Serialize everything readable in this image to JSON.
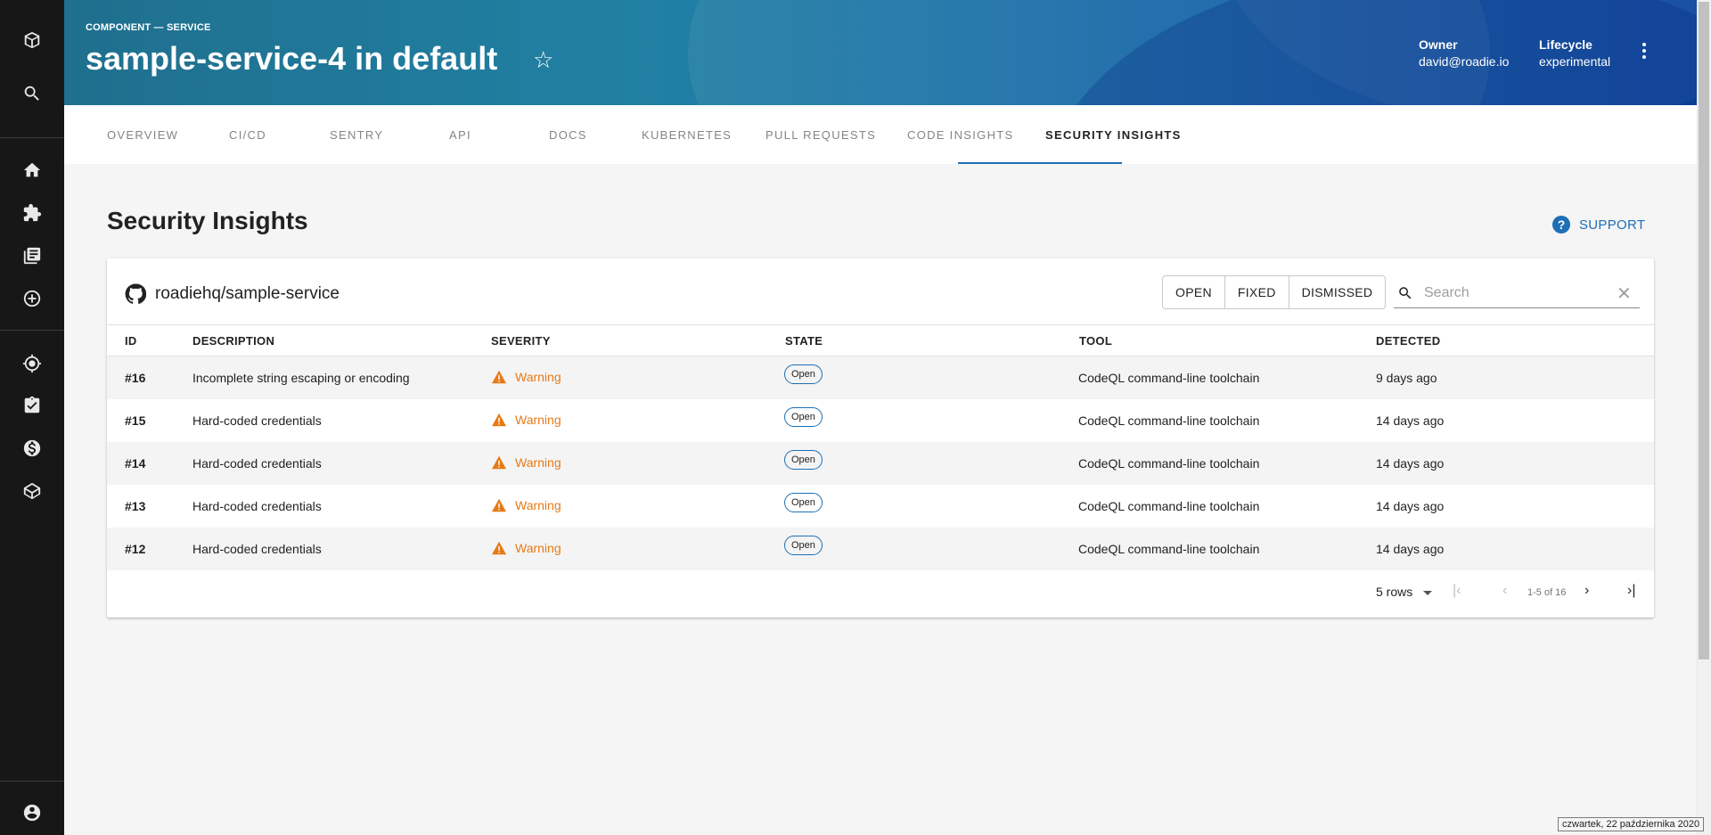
{
  "header": {
    "kicker": "COMPONENT — SERVICE",
    "title": "sample-service-4 in default",
    "owner_label": "Owner",
    "owner_value": "david@roadie.io",
    "lifecycle_label": "Lifecycle",
    "lifecycle_value": "experimental"
  },
  "tabs": [
    {
      "label": "OVERVIEW"
    },
    {
      "label": "CI/CD"
    },
    {
      "label": "SENTRY"
    },
    {
      "label": "API"
    },
    {
      "label": "DOCS"
    },
    {
      "label": "KUBERNETES"
    },
    {
      "label": "PULL REQUESTS"
    },
    {
      "label": "CODE INSIGHTS"
    },
    {
      "label": "SECURITY INSIGHTS",
      "active": true
    }
  ],
  "page": {
    "title": "Security Insights",
    "support_label": "SUPPORT"
  },
  "card": {
    "repo": "roadiehq/sample-service",
    "filters": [
      "OPEN",
      "FIXED",
      "DISMISSED"
    ],
    "search_placeholder": "Search",
    "columns": [
      "ID",
      "DESCRIPTION",
      "SEVERITY",
      "STATE",
      "TOOL",
      "DETECTED"
    ],
    "rows": [
      {
        "id": "#16",
        "description": "Incomplete string escaping or encoding",
        "severity": "Warning",
        "state": "Open",
        "tool": "CodeQL command-line toolchain",
        "detected": "9 days ago"
      },
      {
        "id": "#15",
        "description": "Hard-coded credentials",
        "severity": "Warning",
        "state": "Open",
        "tool": "CodeQL command-line toolchain",
        "detected": "14 days ago"
      },
      {
        "id": "#14",
        "description": "Hard-coded credentials",
        "severity": "Warning",
        "state": "Open",
        "tool": "CodeQL command-line toolchain",
        "detected": "14 days ago"
      },
      {
        "id": "#13",
        "description": "Hard-coded credentials",
        "severity": "Warning",
        "state": "Open",
        "tool": "CodeQL command-line toolchain",
        "detected": "14 days ago"
      },
      {
        "id": "#12",
        "description": "Hard-coded credentials",
        "severity": "Warning",
        "state": "Open",
        "tool": "CodeQL command-line toolchain",
        "detected": "14 days ago"
      }
    ],
    "pagination": {
      "rows_per_page": "5 rows",
      "range": "1-5 of 16"
    }
  },
  "taskbar_date": "czwartek, 22 października 2020",
  "colors": {
    "accent": "#1e6fb5",
    "warning": "#e57a16",
    "sidebar": "#171717"
  },
  "icons": {
    "sidebar": [
      "roadie-logo-icon",
      "search-icon",
      "home-icon",
      "puzzle-icon",
      "library-icon",
      "add-circle-icon",
      "target-icon",
      "assignment-check-icon",
      "dollar-icon",
      "graph-icon",
      "account-circle-icon"
    ]
  }
}
